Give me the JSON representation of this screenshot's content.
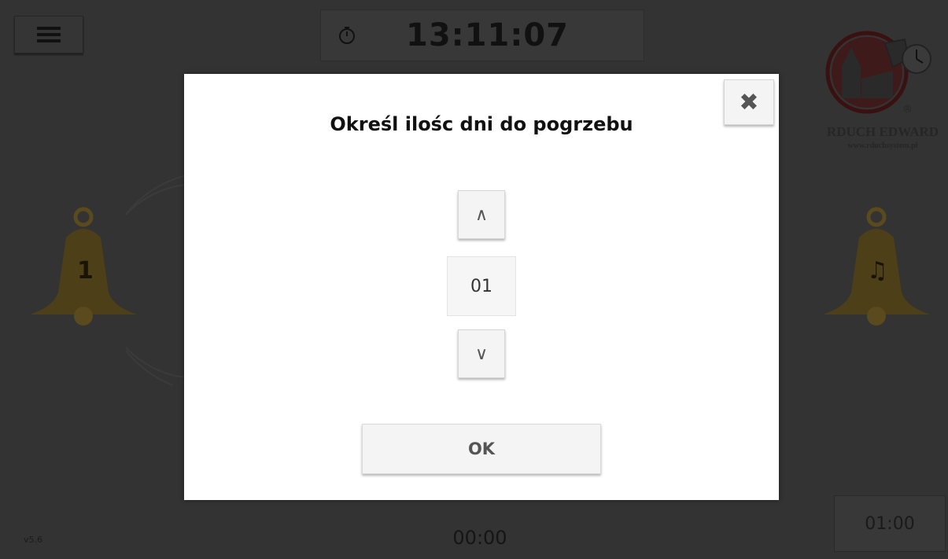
{
  "header": {
    "menu_icon": "hamburger-icon",
    "timer_icon": "stopwatch-icon",
    "clock": "13:11:07"
  },
  "logo": {
    "name": "RDUCH EDWARD",
    "url": "www.rduchsystem.pl",
    "emblem_text": "RDUCH 1975",
    "registered": "®"
  },
  "bells": {
    "left_label": "1",
    "right_label": "♫"
  },
  "footer": {
    "version": "v5.6",
    "time": "00:00",
    "right_time": "01:00"
  },
  "dialog": {
    "title": "Określ ilośc dni do pogrzebu",
    "close_label": "✖",
    "up_label": "∧",
    "value": "01",
    "down_label": "∨",
    "ok_label": "OK"
  },
  "colors": {
    "overlay_bg": "#333333",
    "bell_gold": "#5a4a1e",
    "modal_bg": "#ffffff",
    "button_bg": "#f4f4f4"
  }
}
